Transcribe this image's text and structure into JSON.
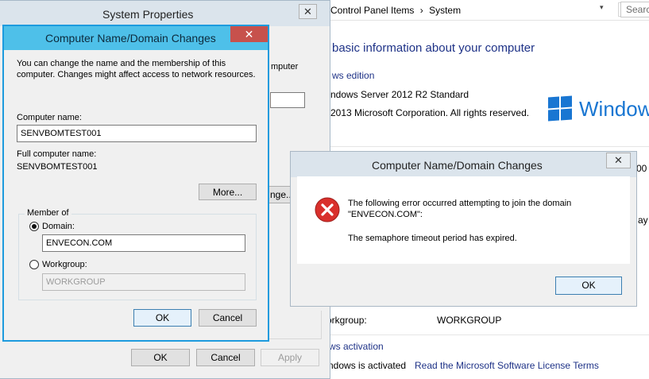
{
  "control_panel": {
    "breadcrumb_1": "Control Panel Items",
    "breadcrumb_sep": "›",
    "breadcrumb_2": "System",
    "search_placeholder": "Searc",
    "heading": "basic information about your computer",
    "edition_section": "ws edition",
    "edition_value": "ndows Server 2012 R2 Standard",
    "copyright": "2013 Microsoft Corporation. All rights reserved.",
    "windows_logo_text": "Window",
    "workgroup_label": "orkgroup:",
    "workgroup_value": "WORKGROUP",
    "activation_section": "ws activation",
    "activation_status": "ndows is activated",
    "license_link": "Read the Microsoft Software License Terms",
    "partial_00": "00 (",
    "partial_ay": "ay"
  },
  "system_properties": {
    "title": "System Properties",
    "close_glyph": "✕",
    "partial_computer": "mputer",
    "partial_change": "nge...",
    "ok_label": "OK",
    "cancel_label": "Cancel",
    "apply_label": "Apply"
  },
  "name_dialog": {
    "title": "Computer Name/Domain Changes",
    "close_glyph": "✕",
    "description_line1": "You can change the name and the membership of this",
    "description_line2": "computer. Changes might affect access to network resources.",
    "computer_name_label": "Computer name:",
    "computer_name_value": "SENVBOMTEST001",
    "full_name_label": "Full computer name:",
    "full_name_value": "SENVBOMTEST001",
    "more_label": "More...",
    "member_of_label": "Member of",
    "domain_label": "Domain:",
    "domain_value": "ENVECON.COM",
    "workgroup_label": "Workgroup:",
    "workgroup_value": "WORKGROUP",
    "ok_label": "OK",
    "cancel_label": "Cancel"
  },
  "error_dialog": {
    "title": "Computer Name/Domain Changes",
    "close_glyph": "✕",
    "message_line1": "The following error occurred attempting to join the domain",
    "message_line2": "\"ENVECON.COM\":",
    "message_line3": "The semaphore timeout period has expired.",
    "ok_label": "OK"
  },
  "colors": {
    "error_red": "#d9302c",
    "accent_blue": "#1d9bde",
    "windows_blue": "#1976d2"
  }
}
